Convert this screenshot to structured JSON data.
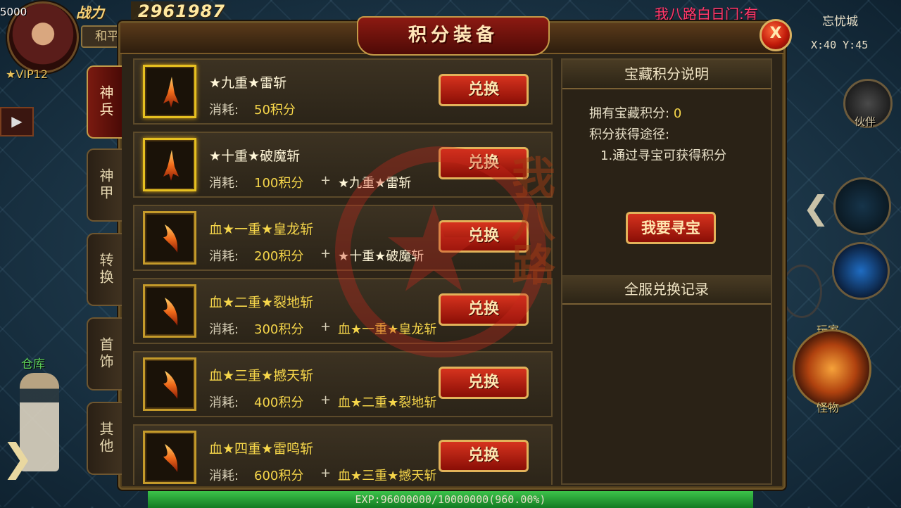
{
  "hud": {
    "hp_small": "5000",
    "power_label": "战力",
    "power_value": "2961987",
    "peace_mode": "和平",
    "vip": "★VIP12",
    "warehouse": "仓库",
    "chat": "我八路白日门:有",
    "map_name": "忘忧城",
    "coords": "X:40 Y:45",
    "partner": "伙伴",
    "player": "玩家",
    "monster": "怪物",
    "exp_text": "EXP:96000000/10000000(960.00%)",
    "exp_fraction": 1.0
  },
  "dialog": {
    "title": "积分装备",
    "close_label": "X",
    "tabs": [
      {
        "label": "神兵",
        "active": true
      },
      {
        "label": "神甲",
        "active": false
      },
      {
        "label": "转换",
        "active": false
      },
      {
        "label": "首饰",
        "active": false
      },
      {
        "label": "其他",
        "active": false
      }
    ],
    "cost_label": "消耗:",
    "plus": "+",
    "exchange_label": "兑换",
    "items": [
      {
        "name": "★九重★雷斩",
        "cost": "50积分",
        "requires": "",
        "style": "white",
        "slot": "gold"
      },
      {
        "name": "★十重★破魔斩",
        "cost": "100积分",
        "requires": "★九重★雷斩",
        "style": "white",
        "slot": "gold"
      },
      {
        "name": "血★一重★皇龙斩",
        "cost": "200积分",
        "requires": "★十重★破魔斩",
        "style": "blood",
        "slot": "normal"
      },
      {
        "name": "血★二重★裂地斩",
        "cost": "300积分",
        "requires": "血★一重★皇龙斩",
        "style": "blood",
        "slot": "normal"
      },
      {
        "name": "血★三重★撼天斩",
        "cost": "400积分",
        "requires": "血★二重★裂地斩",
        "style": "blood",
        "slot": "normal"
      },
      {
        "name": "血★四重★雷鸣斩",
        "cost": "600积分",
        "requires": "血★三重★撼天斩",
        "style": "blood",
        "slot": "normal"
      }
    ],
    "info": {
      "title": "宝藏积分说明",
      "owned_label": "拥有宝藏积分:",
      "owned_value": "0",
      "ways_label": "积分获得途径:",
      "way1": "1.通过寻宝可获得积分",
      "treasure_button": "我要寻宝",
      "records_title": "全服兑换记录"
    }
  }
}
